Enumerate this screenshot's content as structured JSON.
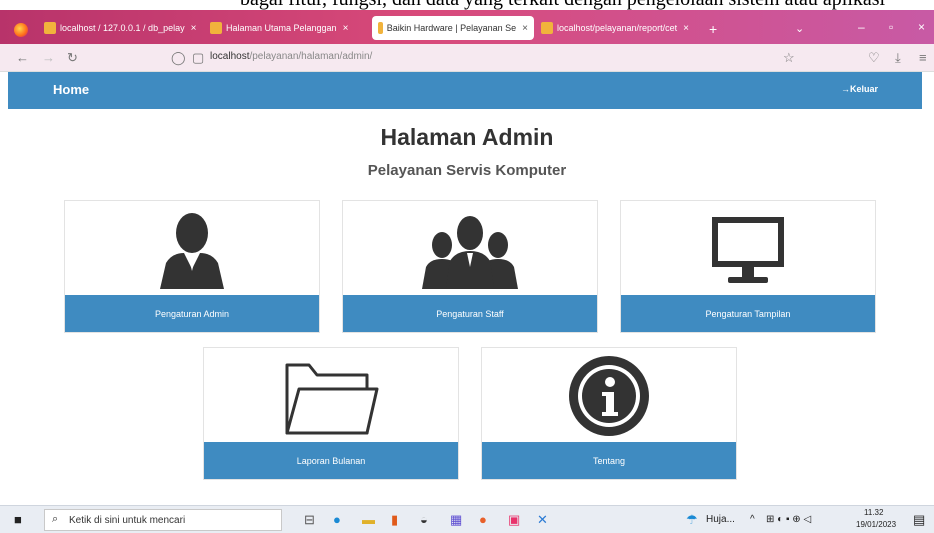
{
  "caption": "bagai fitur, fungsi, dan data yang terkait dengan pengelolaan sistem atau aplikasi",
  "browser": {
    "tabs": [
      {
        "label": "localhost / 127.0.0.1 / db_pelay"
      },
      {
        "label": "Halaman Utama Pelanggan"
      },
      {
        "label": "Baikin Hardware | Pelayanan Se"
      },
      {
        "label": "localhost/pelayanan/report/cet"
      }
    ],
    "url_host": "localhost",
    "url_path": "/pelayanan/halaman/admin/"
  },
  "header": {
    "home": "Home",
    "logout": "→Keluar"
  },
  "page": {
    "title": "Halaman Admin",
    "subtitle": "Pelayanan Servis Komputer"
  },
  "cards": [
    {
      "label": "Pengaturan Admin",
      "icon": "person-icon"
    },
    {
      "label": "Pengaturan Staff",
      "icon": "group-icon"
    },
    {
      "label": "Pengaturan Tampilan",
      "icon": "monitor-icon"
    },
    {
      "label": "Laporan Bulanan",
      "icon": "folder-icon"
    },
    {
      "label": "Tentang",
      "icon": "info-icon"
    }
  ],
  "taskbar": {
    "search_placeholder": "Ketik di sini untuk mencari",
    "weather": "Huja...",
    "time": "11.32",
    "date": "19/01/2023"
  },
  "colors": {
    "accent": "#3f8bc1",
    "tabbar": "#c83a78"
  }
}
